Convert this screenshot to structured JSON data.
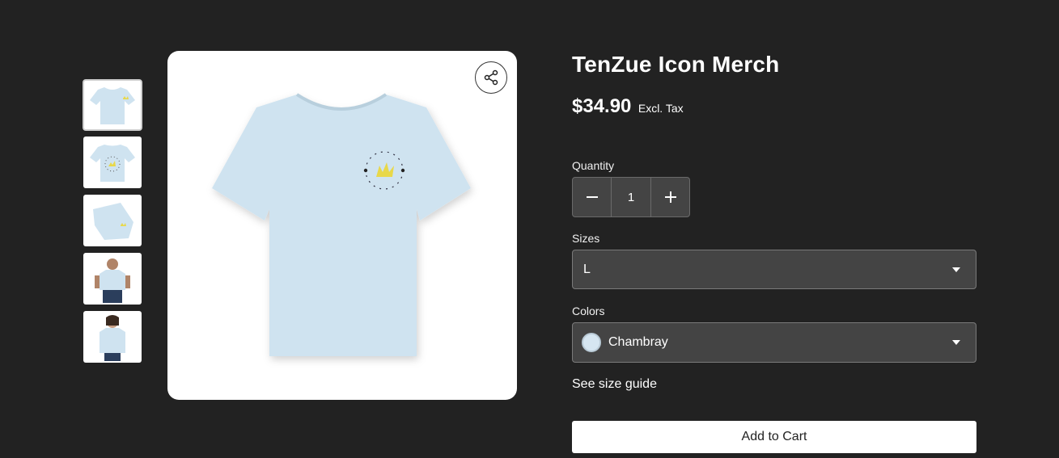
{
  "product": {
    "title": "TenZue Icon Merch",
    "price": "$34.90",
    "tax_note": "Excl. Tax",
    "thumbnails": [
      "shirt-front",
      "shirt-back",
      "shirt-folded",
      "model-male",
      "model-female"
    ]
  },
  "quantity": {
    "label": "Quantity",
    "value": "1"
  },
  "sizes": {
    "label": "Sizes",
    "selected": "L"
  },
  "colors": {
    "label": "Colors",
    "selected": "Chambray",
    "swatch": "#d6e6f1"
  },
  "links": {
    "size_guide": "See size guide"
  },
  "actions": {
    "add_to_cart": "Add to Cart"
  },
  "theme": {
    "background": "#222222",
    "field": "#444444",
    "shirt": "#cfe3f0",
    "logo": "#e8d84a"
  }
}
